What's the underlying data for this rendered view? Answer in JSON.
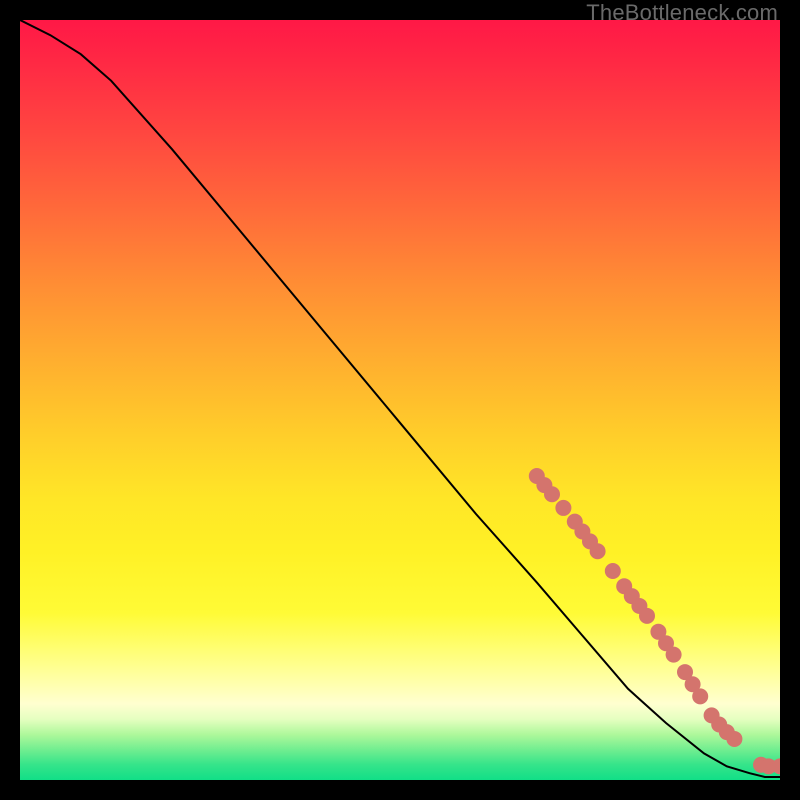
{
  "watermark": "TheBottleneck.com",
  "colors": {
    "background": "#000000",
    "dot": "#d4746d",
    "curve": "#000000"
  },
  "chart_data": {
    "type": "line",
    "title": "",
    "xlabel": "",
    "ylabel": "",
    "xlim": [
      0,
      100
    ],
    "ylim": [
      0,
      100
    ],
    "annotations": [
      "TheBottleneck.com"
    ],
    "series": [
      {
        "name": "curve",
        "x": [
          0,
          4,
          8,
          12,
          20,
          30,
          40,
          50,
          60,
          68,
          74,
          80,
          85,
          90,
          93,
          96,
          98,
          100
        ],
        "y": [
          100,
          98,
          95.5,
          92,
          83,
          71,
          59,
          47,
          35,
          26,
          19,
          12,
          7.5,
          3.5,
          1.8,
          0.9,
          0.4,
          0.4
        ]
      }
    ],
    "points": [
      {
        "x": 68,
        "y": 40
      },
      {
        "x": 69,
        "y": 38.8
      },
      {
        "x": 70,
        "y": 37.6
      },
      {
        "x": 71.5,
        "y": 35.8
      },
      {
        "x": 73,
        "y": 34
      },
      {
        "x": 74,
        "y": 32.7
      },
      {
        "x": 75,
        "y": 31.4
      },
      {
        "x": 76,
        "y": 30.1
      },
      {
        "x": 78,
        "y": 27.5
      },
      {
        "x": 79.5,
        "y": 25.5
      },
      {
        "x": 80.5,
        "y": 24.2
      },
      {
        "x": 81.5,
        "y": 22.9
      },
      {
        "x": 82.5,
        "y": 21.6
      },
      {
        "x": 84,
        "y": 19.5
      },
      {
        "x": 85,
        "y": 18
      },
      {
        "x": 86,
        "y": 16.5
      },
      {
        "x": 87.5,
        "y": 14.2
      },
      {
        "x": 88.5,
        "y": 12.6
      },
      {
        "x": 89.5,
        "y": 11
      },
      {
        "x": 91,
        "y": 8.5
      },
      {
        "x": 92,
        "y": 7.3
      },
      {
        "x": 93,
        "y": 6.3
      },
      {
        "x": 94,
        "y": 5.4
      },
      {
        "x": 97.5,
        "y": 2.0
      },
      {
        "x": 98.5,
        "y": 1.8
      },
      {
        "x": 100,
        "y": 1.8
      }
    ]
  }
}
